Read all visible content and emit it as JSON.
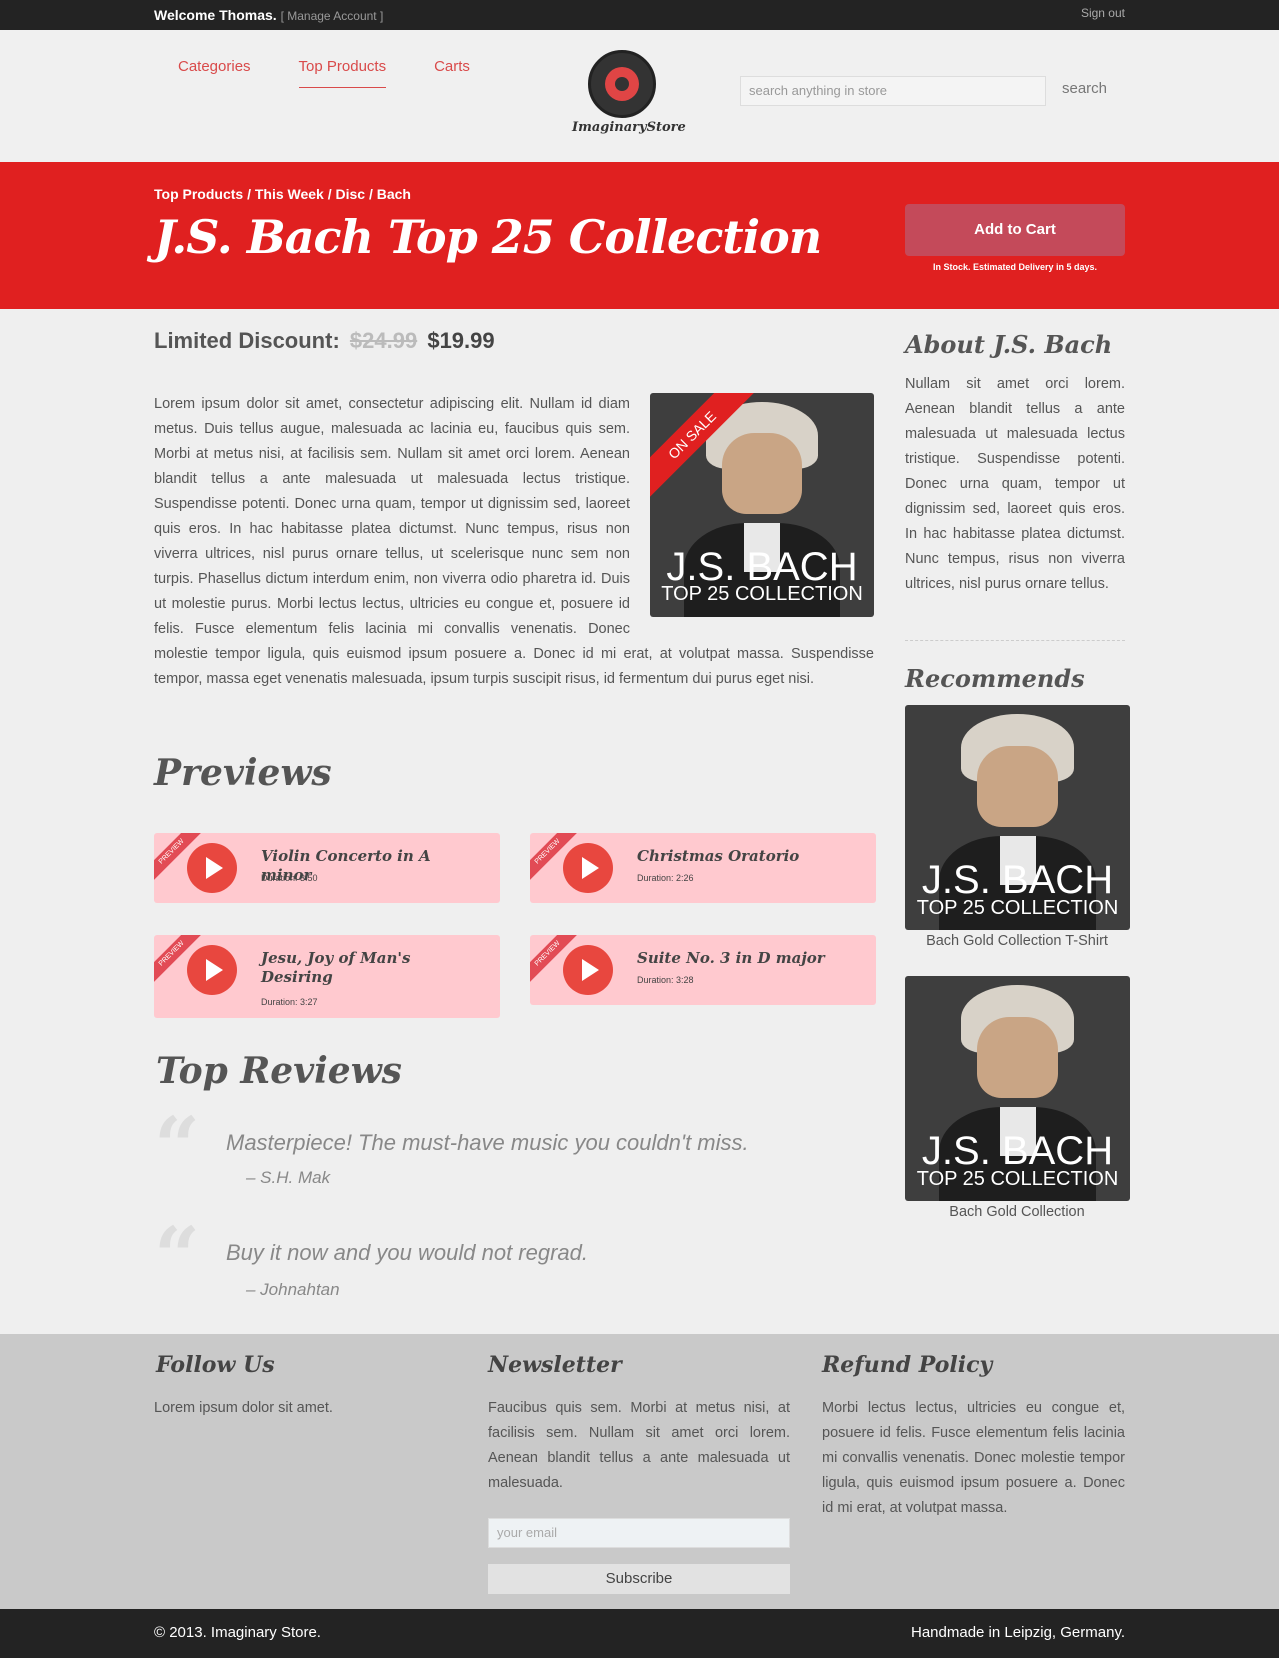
{
  "topbar": {
    "welcome": "Welcome Thomas.",
    "manage": "[ Manage Account ]",
    "signout": "Sign out"
  },
  "nav": {
    "categories": "Categories",
    "top_products": "Top Products",
    "carts": "Carts"
  },
  "logo": {
    "name": "ImaginaryStore"
  },
  "search": {
    "placeholder": "search anything in store",
    "button": "search"
  },
  "hero": {
    "breadcrumb": "Top Products / This Week / Disc / Bach",
    "title": "J.S. Bach Top 25 Collection",
    "add_to_cart": "Add to Cart",
    "stock": "In Stock. Estimated Delivery in 5 days."
  },
  "price": {
    "label": "Limited Discount:",
    "old": "$24.99",
    "new": "$19.99"
  },
  "description": "Lorem ipsum dolor sit amet, consectetur adipiscing elit. Nullam id diam metus. Duis tellus augue, malesuada ac lacinia eu, faucibus quis sem. Morbi at metus nisi, at facilisis sem. Nullam sit amet orci lorem. Aenean blandit tellus a ante malesuada ut malesuada lectus tristique. Suspendisse potenti. Donec urna quam, tempor ut dignissim sed, laoreet quis eros. In hac habitasse platea dictumst. Nunc tempus, risus non viverra ultrices, nisl purus ornare tellus, ut scelerisque nunc sem non turpis. Phasellus dictum interdum enim, non viverra odio pharetra id. Duis ut molestie purus. Morbi lectus lectus, ultricies eu congue et, posuere id felis. Fusce elementum felis lacinia mi convallis venenatis. Donec molestie tempor ligula, quis euismod ipsum posuere a. Donec id mi erat, at volutpat massa. Suspendisse tempor, massa eget venenatis malesuada, ipsum turpis suscipit risus, id fermentum dui purus eget nisi.",
  "album": {
    "line1": "J.S. BACH",
    "line2": "TOP 25 COLLECTION",
    "ribbon": "ON SALE"
  },
  "previews": {
    "title": "Previews",
    "ribbon": "PREVIEW",
    "items": [
      {
        "title": "Violin Concerto in A minor",
        "duration": "Duration: 3:50"
      },
      {
        "title": "Christmas Oratorio",
        "duration": "Duration: 2:26"
      },
      {
        "title": "Jesu, Joy of Man's Desiring",
        "duration": "Duration: 3:27"
      },
      {
        "title": "Suite No. 3 in D major",
        "duration": "Duration: 3:28"
      }
    ]
  },
  "reviews": {
    "title": "Top Reviews",
    "items": [
      {
        "text": "Masterpiece! The must-have music you couldn't miss.",
        "author": "– S.H. Mak"
      },
      {
        "text": "Buy it now and you would not regrad.",
        "author": "– Johnahtan"
      }
    ]
  },
  "sidebar": {
    "about_title": "About J.S. Bach",
    "about_text": "Nullam sit amet orci lorem. Aenean blandit tellus a ante malesuada ut malesuada lectus tristique. Suspendisse potenti. Donec urna quam, tempor ut dignissim sed, laoreet quis eros. In hac habitasse platea dictumst. Nunc tempus, risus non viverra ultrices, nisl purus ornare tellus.",
    "recommends_title": "Recommends",
    "recommends": [
      {
        "caption": "Bach Gold Collection T-Shirt"
      },
      {
        "caption": "Bach Gold Collection"
      }
    ]
  },
  "footer": {
    "follow_title": "Follow Us",
    "follow_text": "Lorem ipsum dolor sit amet.",
    "newsletter_title": "Newsletter",
    "newsletter_text": "Faucibus quis sem. Morbi at metus nisi, at facilisis sem. Nullam sit amet orci lorem. Aenean blandit tellus a ante malesuada ut malesuada.",
    "email_placeholder": "your email",
    "subscribe": "Subscribe",
    "refund_title": "Refund Policy",
    "refund_text": "Morbi lectus lectus, ultricies eu congue et, posuere id felis. Fusce elementum felis lacinia mi convallis venenatis. Donec molestie tempor ligula, quis euismod ipsum posuere a. Donec id mi erat, at volutpat massa.",
    "copyright": "© 2013. Imaginary Store.",
    "handmade": "Handmade in Leipzig, Germany."
  },
  "colors": {
    "accent": "#e02020",
    "link": "#d94a4a",
    "dark": "#232323",
    "preview_bg": "#ffc9cf"
  }
}
